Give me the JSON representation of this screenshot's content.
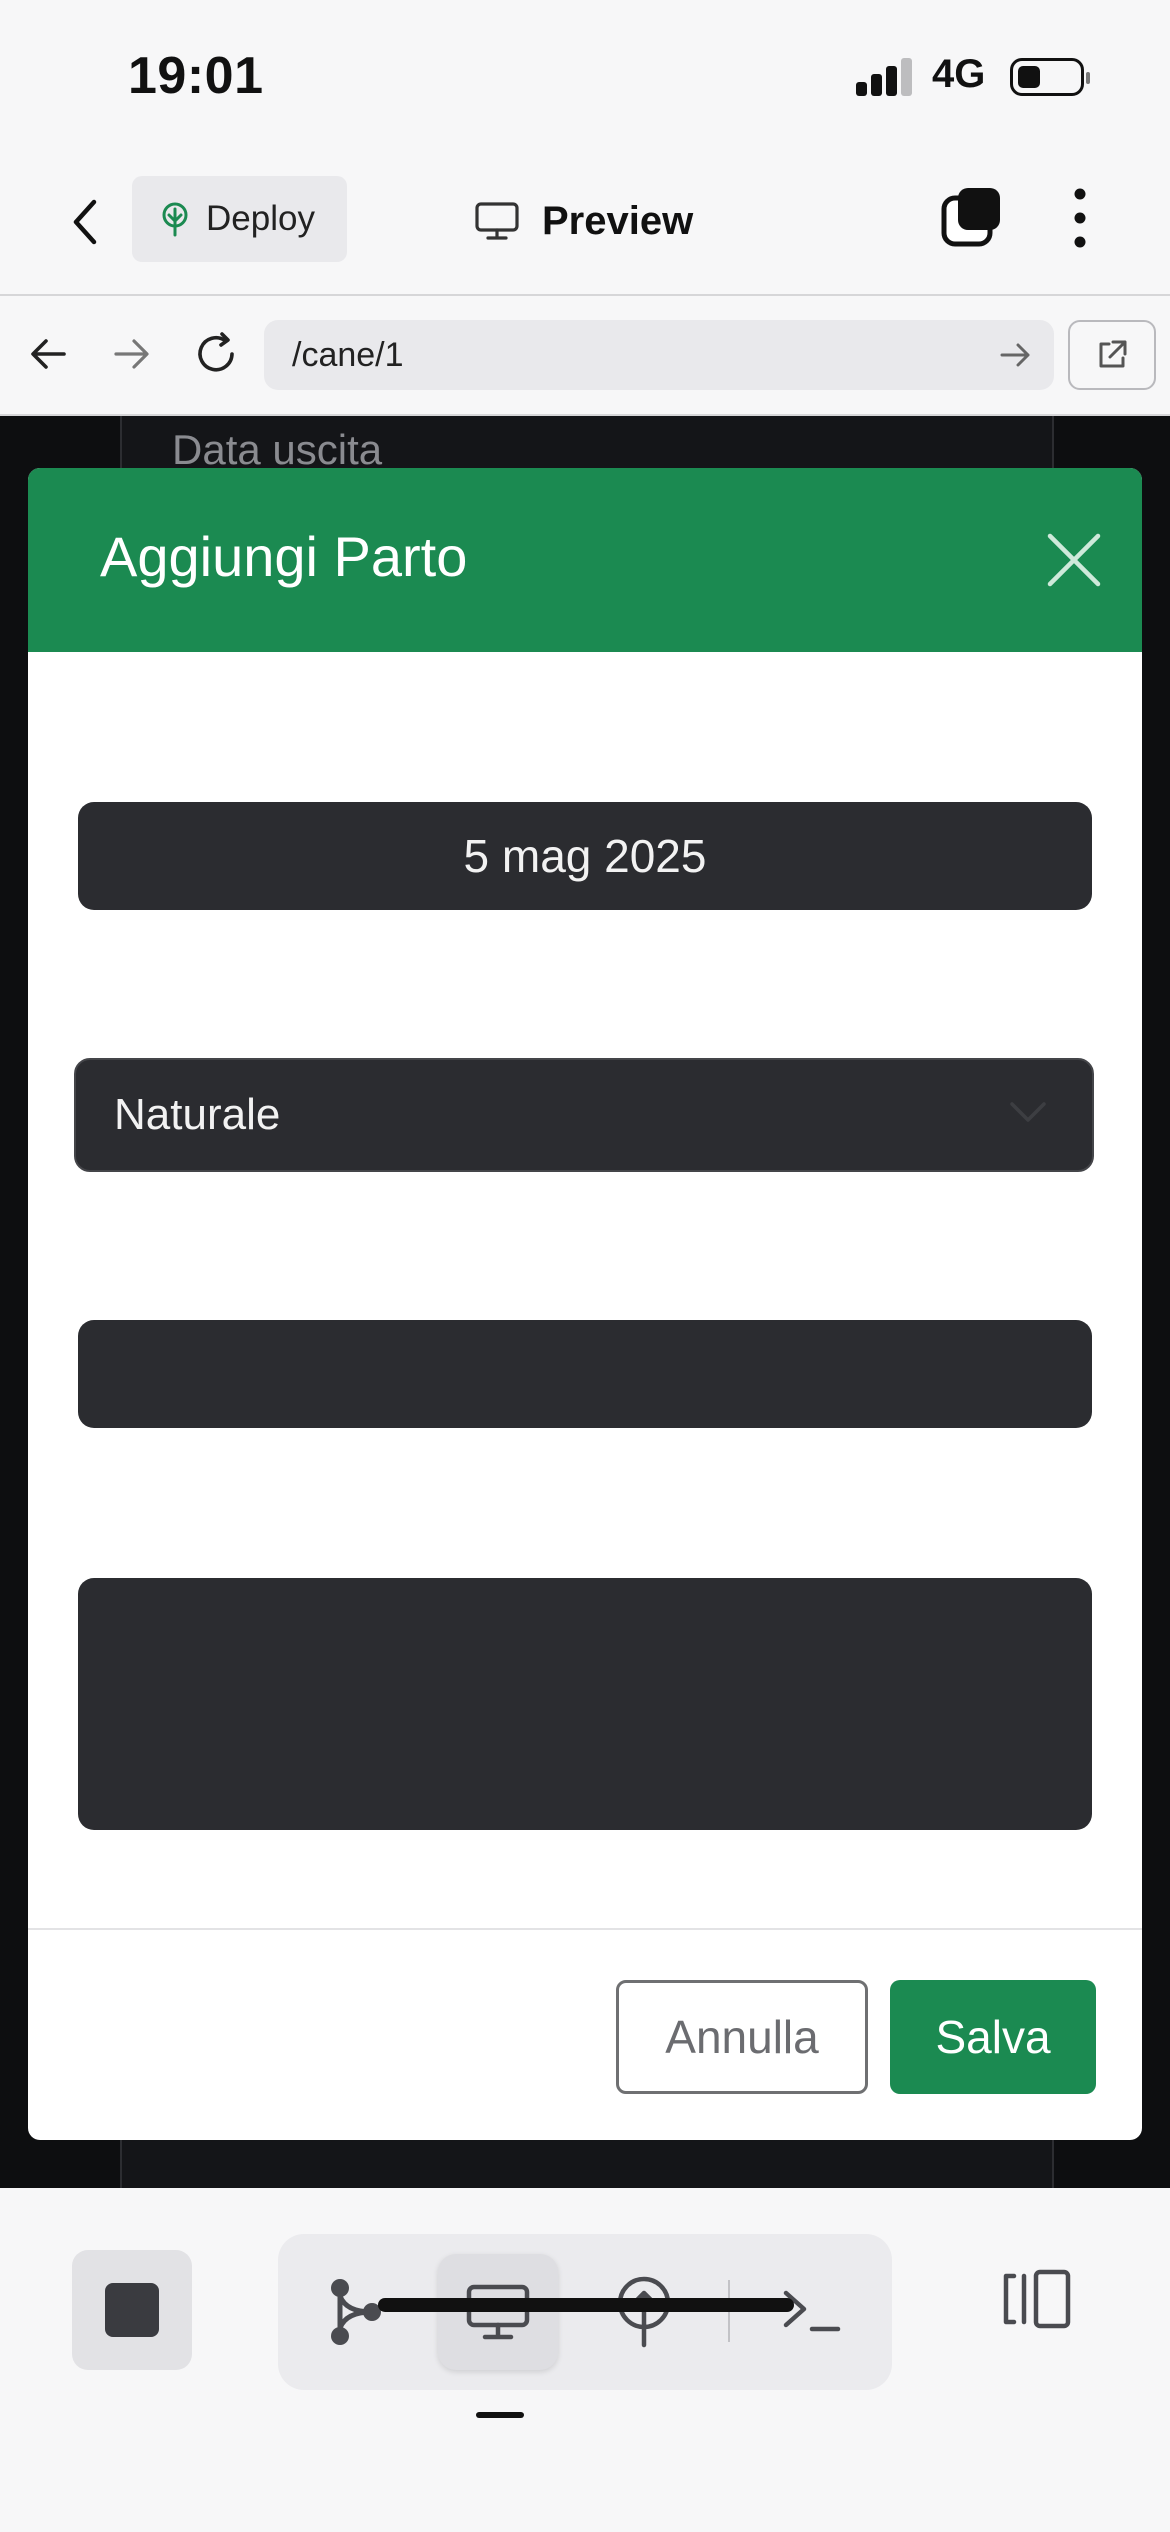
{
  "status_bar": {
    "time": "19:01",
    "network": "4G"
  },
  "header": {
    "deploy_label": "Deploy",
    "preview_label": "Preview"
  },
  "browser": {
    "url": "/cane/1"
  },
  "background": {
    "field_label": "Data uscita"
  },
  "modal": {
    "title": "Aggiungi Parto",
    "date_value": "5 mag 2025",
    "select_value": "Naturale",
    "text_field_value": "",
    "textarea_value": "",
    "cancel_label": "Annulla",
    "save_label": "Salva"
  },
  "colors": {
    "accent": "#1b8a51",
    "field_bg": "#2b2c30",
    "overlay_bg": "#0d0e10"
  },
  "icons": {
    "header": [
      "chevron-left-icon",
      "deploy-tree-icon",
      "monitor-icon",
      "stack-icon",
      "more-vertical-icon"
    ],
    "browser": [
      "arrow-left-icon",
      "arrow-right-icon",
      "reload-icon",
      "go-arrow-icon",
      "external-link-icon"
    ],
    "toolbar": [
      "stop-icon",
      "git-branch-icon",
      "monitor-icon",
      "deploy-antenna-icon",
      "terminal-icon",
      "panel-icon"
    ]
  }
}
